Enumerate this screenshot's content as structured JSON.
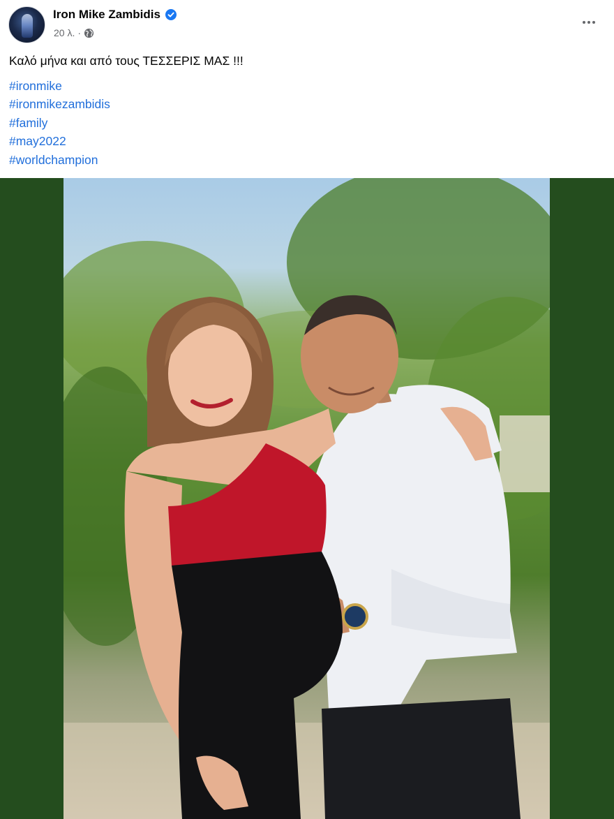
{
  "post": {
    "author_name": "Iron Mike Zambidis",
    "verified": true,
    "timestamp": "20 λ.",
    "separator": "·",
    "audience_icon": "globe-icon",
    "more_icon": "more-options-icon",
    "caption": "Καλό μήνα και από τους ΤΕΣΣΕΡΙΣ ΜΑΣ !!!",
    "hashtags": [
      "#ironmike",
      "#ironmikezambidis",
      "#family",
      "#may2022",
      "#worldchampion"
    ]
  },
  "colors": {
    "hashtag": "#216fdb",
    "verified_badge": "#1877f2",
    "frame_background": "#244d1e"
  }
}
